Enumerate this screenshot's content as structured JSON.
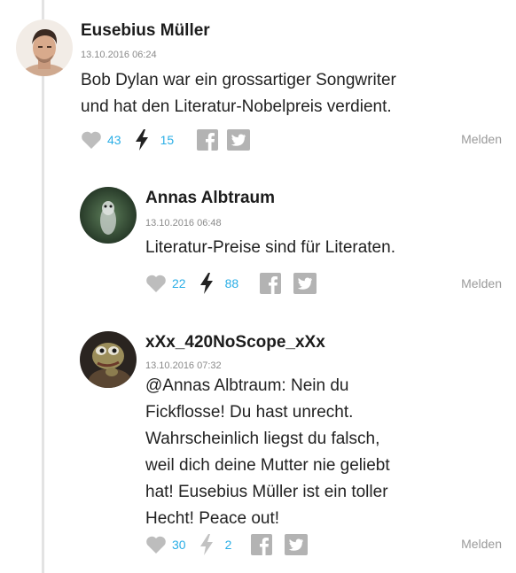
{
  "colors": {
    "accent": "#2aaee6",
    "icon_gray": "#9a9a9a",
    "bolt_dark": "#222222",
    "thread_line": "#e3e3e3"
  },
  "comments": [
    {
      "author": "Eusebius Müller",
      "timestamp": "13.10.2016 06:24",
      "text_lines": [
        "Bob Dylan war ein grossartiger Songwriter",
        "und hat den Literatur-Nobelpreis verdient."
      ],
      "likes": "43",
      "bolts": "15",
      "report_label": "Melden",
      "icons": [
        "heart-icon",
        "bolt-icon",
        "facebook-icon",
        "twitter-icon"
      ]
    },
    {
      "author": "Annas Albtraum",
      "timestamp": "13.10.2016 06:48",
      "text_lines": [
        "Literatur-Preise sind für Literaten."
      ],
      "likes": "22",
      "bolts": "88",
      "report_label": "Melden",
      "icons": [
        "heart-icon",
        "bolt-icon",
        "facebook-icon",
        "twitter-icon"
      ]
    },
    {
      "author": "xXx_420NoScope_xXx",
      "timestamp": "13.10.2016 07:32",
      "text_lines": [
        "@Annas Albtraum: Nein du",
        "Fickflosse! Du hast unrecht.",
        "Wahrscheinlich liegst du falsch,",
        "weil dich deine Mutter nie geliebt",
        "hat! Eusebius Müller ist ein toller",
        "Hecht! Peace out!"
      ],
      "likes": "30",
      "bolts": "2",
      "report_label": "Melden",
      "icons": [
        "heart-icon",
        "bolt-icon",
        "facebook-icon",
        "twitter-icon"
      ]
    }
  ]
}
